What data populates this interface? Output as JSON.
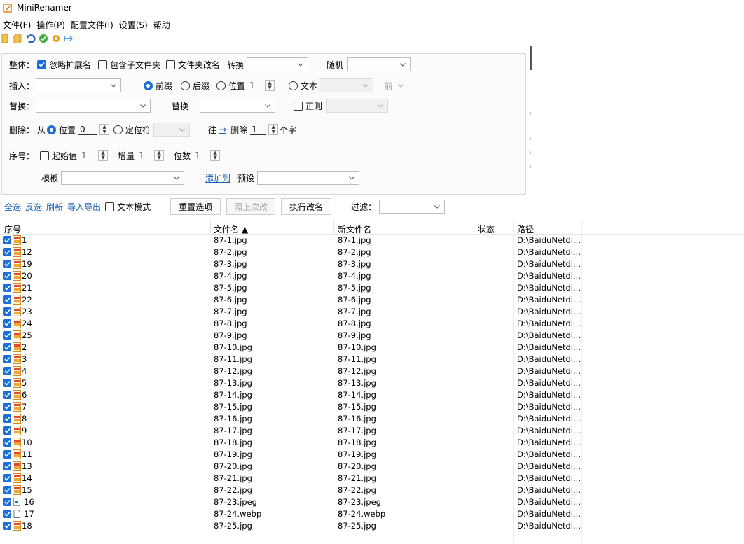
{
  "window": {
    "title": "MiniRenamer"
  },
  "menu": [
    "文件(F)",
    "操作(P)",
    "配置文件(I)",
    "设置(S)",
    "帮助"
  ],
  "toolbar_icons": [
    "open-icon",
    "folder-icon",
    "undo-icon",
    "ok-icon",
    "settings-icon",
    "pin-icon"
  ],
  "whole": {
    "label": "整体：",
    "ignore_ext": "忽略扩展名",
    "include_sub": "包含子文件夹",
    "folder_rename": "文件夹改名",
    "convert": "转换",
    "convert_value": "",
    "random": "随机",
    "random_value": ""
  },
  "insert": {
    "label": "插入：",
    "value": "",
    "prefix": "前缀",
    "suffix": "后缀",
    "position": "位置",
    "position_value": "1",
    "text": "文本",
    "text_value": "",
    "direction": "前"
  },
  "replace": {
    "label": "替换：",
    "find_value": "",
    "replace_label": "替换",
    "replace_value": "",
    "regex": "正则",
    "regex_value": ""
  },
  "delete": {
    "label": "删除：",
    "from": "从",
    "position": "位置",
    "position_value": "0",
    "locator": "定位符",
    "locator_value": "",
    "toward": "往",
    "arrow": "→",
    "delete_label": "删除",
    "count_value": "1",
    "unit": "个字"
  },
  "sequence": {
    "label": "序号：",
    "start": "起始值",
    "start_value": "1",
    "step": "增量",
    "step_value": "1",
    "digits": "位数",
    "digits_value": "1",
    "template": "模板",
    "template_value": "",
    "add_to": "添加到",
    "preset": "预设",
    "preset_value": ""
  },
  "actions": {
    "select_all": "全选",
    "invert": "反选",
    "refresh": "刷新",
    "import_export": "导入导出",
    "text_mode": "文本模式",
    "reset": "重置选项",
    "repeat_last": "照上次改",
    "run": "执行改名",
    "filter": "过滤：",
    "filter_value": ""
  },
  "table": {
    "headers": {
      "seq": "序号",
      "filename": "文件名 ▲",
      "newname": "新文件名",
      "status": "状态",
      "path": "路径"
    },
    "rows": [
      {
        "seq": "1",
        "file": "87-1.jpg",
        "new": "87-1.jpg",
        "path": "D:\\BaiduNetdi...",
        "icon": "image"
      },
      {
        "seq": "12",
        "file": "87-2.jpg",
        "new": "87-2.jpg",
        "path": "D:\\BaiduNetdi...",
        "icon": "image"
      },
      {
        "seq": "19",
        "file": "87-3.jpg",
        "new": "87-3.jpg",
        "path": "D:\\BaiduNetdi...",
        "icon": "image"
      },
      {
        "seq": "20",
        "file": "87-4.jpg",
        "new": "87-4.jpg",
        "path": "D:\\BaiduNetdi...",
        "icon": "image"
      },
      {
        "seq": "21",
        "file": "87-5.jpg",
        "new": "87-5.jpg",
        "path": "D:\\BaiduNetdi...",
        "icon": "image"
      },
      {
        "seq": "22",
        "file": "87-6.jpg",
        "new": "87-6.jpg",
        "path": "D:\\BaiduNetdi...",
        "icon": "image"
      },
      {
        "seq": "23",
        "file": "87-7.jpg",
        "new": "87-7.jpg",
        "path": "D:\\BaiduNetdi...",
        "icon": "image"
      },
      {
        "seq": "24",
        "file": "87-8.jpg",
        "new": "87-8.jpg",
        "path": "D:\\BaiduNetdi...",
        "icon": "image"
      },
      {
        "seq": "25",
        "file": "87-9.jpg",
        "new": "87-9.jpg",
        "path": "D:\\BaiduNetdi...",
        "icon": "image"
      },
      {
        "seq": "2",
        "file": "87-10.jpg",
        "new": "87-10.jpg",
        "path": "D:\\BaiduNetdi...",
        "icon": "image"
      },
      {
        "seq": "3",
        "file": "87-11.jpg",
        "new": "87-11.jpg",
        "path": "D:\\BaiduNetdi...",
        "icon": "image"
      },
      {
        "seq": "4",
        "file": "87-12.jpg",
        "new": "87-12.jpg",
        "path": "D:\\BaiduNetdi...",
        "icon": "image"
      },
      {
        "seq": "5",
        "file": "87-13.jpg",
        "new": "87-13.jpg",
        "path": "D:\\BaiduNetdi...",
        "icon": "image"
      },
      {
        "seq": "6",
        "file": "87-14.jpg",
        "new": "87-14.jpg",
        "path": "D:\\BaiduNetdi...",
        "icon": "image"
      },
      {
        "seq": "7",
        "file": "87-15.jpg",
        "new": "87-15.jpg",
        "path": "D:\\BaiduNetdi...",
        "icon": "image"
      },
      {
        "seq": "8",
        "file": "87-16.jpg",
        "new": "87-16.jpg",
        "path": "D:\\BaiduNetdi...",
        "icon": "image"
      },
      {
        "seq": "9",
        "file": "87-17.jpg",
        "new": "87-17.jpg",
        "path": "D:\\BaiduNetdi...",
        "icon": "image"
      },
      {
        "seq": "10",
        "file": "87-18.jpg",
        "new": "87-18.jpg",
        "path": "D:\\BaiduNetdi...",
        "icon": "image"
      },
      {
        "seq": "11",
        "file": "87-19.jpg",
        "new": "87-19.jpg",
        "path": "D:\\BaiduNetdi...",
        "icon": "image"
      },
      {
        "seq": "13",
        "file": "87-20.jpg",
        "new": "87-20.jpg",
        "path": "D:\\BaiduNetdi...",
        "icon": "image"
      },
      {
        "seq": "14",
        "file": "87-21.jpg",
        "new": "87-21.jpg",
        "path": "D:\\BaiduNetdi...",
        "icon": "image"
      },
      {
        "seq": "15",
        "file": "87-22.jpg",
        "new": "87-22.jpg",
        "path": "D:\\BaiduNetdi...",
        "icon": "image"
      },
      {
        "seq": "16",
        "file": "87-23.jpeg",
        "new": "87-23.jpeg",
        "path": "D:\\BaiduNetdi...",
        "icon": "jpeg"
      },
      {
        "seq": "17",
        "file": "87-24.webp",
        "new": "87-24.webp",
        "path": "D:\\BaiduNetdi...",
        "icon": "blank"
      },
      {
        "seq": "18",
        "file": "87-25.jpg",
        "new": "87-25.jpg",
        "path": "D:\\BaiduNetdi...",
        "icon": "image"
      }
    ]
  },
  "colors": {
    "accent": "#1b6fd6",
    "link": "#1a5fb4",
    "border": "#d9d9d9"
  }
}
